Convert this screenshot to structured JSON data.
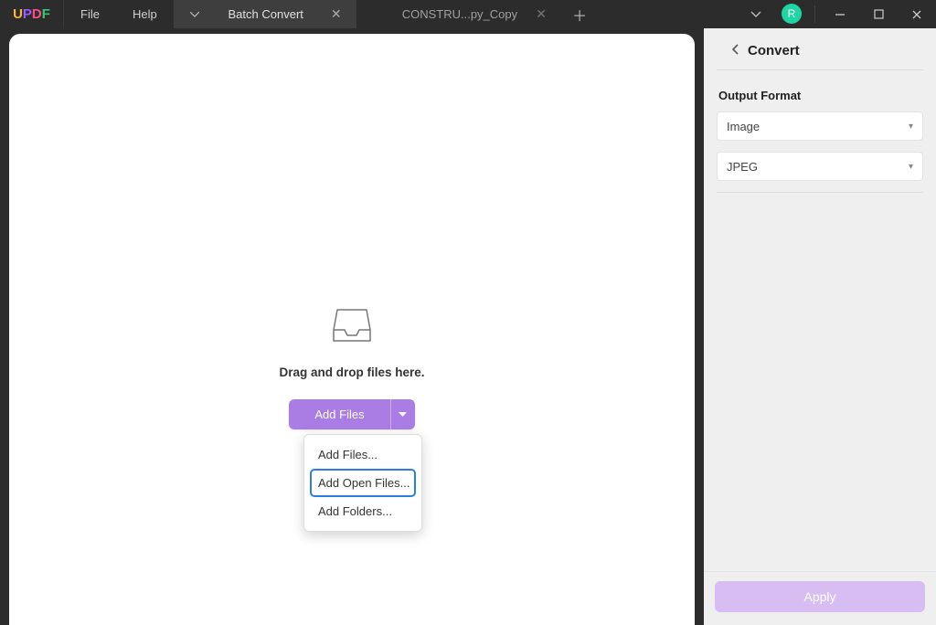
{
  "logo": {
    "u": "U",
    "p": "P",
    "d": "D",
    "f": "F"
  },
  "menu": {
    "file": "File",
    "help": "Help"
  },
  "tabs": {
    "active": {
      "label": "Batch Convert"
    },
    "inactive": {
      "label": "CONSTRU...py_Copy"
    }
  },
  "avatar": {
    "initial": "R"
  },
  "dropzone": {
    "text": "Drag and drop files here.",
    "button": "Add Files",
    "menu": {
      "add_files": "Add Files...",
      "add_open_files": "Add Open Files...",
      "add_folders": "Add Folders..."
    }
  },
  "panel": {
    "title": "Convert",
    "output_format_label": "Output Format",
    "format_value": "Image",
    "subformat_value": "JPEG",
    "apply": "Apply"
  }
}
